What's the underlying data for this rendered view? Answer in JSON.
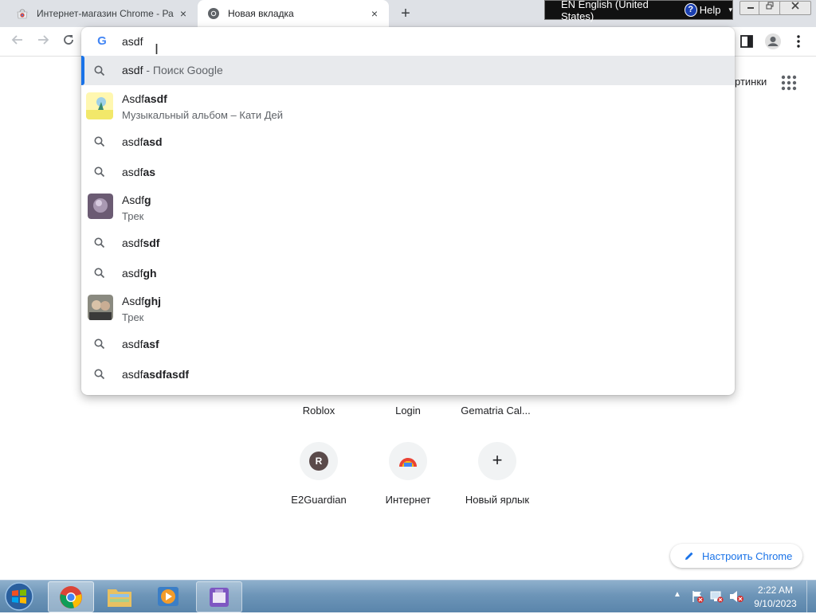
{
  "tabs": [
    {
      "title": "Интернет-магазин Chrome - Рас",
      "close_label": "×",
      "icon": "chrome-webstore-icon"
    },
    {
      "title": "Новая вкладка",
      "close_label": "×",
      "icon": "chrome-icon"
    }
  ],
  "new_tab_label": "+",
  "ime": {
    "language": "EN English (United States)",
    "help_label": "Help",
    "help_glyph": "?"
  },
  "omnibox": {
    "input_value": "asdf",
    "suggestions": [
      {
        "type": "search",
        "main": "asdf",
        "bold": "",
        "detail": " - Поиск Google",
        "selected": true
      },
      {
        "type": "entity",
        "main": "Asdf",
        "bold": "asdf",
        "subtitle": "Музыкальный альбом – Кати Дей"
      },
      {
        "type": "search",
        "main": "asdf",
        "bold": "asd"
      },
      {
        "type": "search",
        "main": "asdf",
        "bold": "as"
      },
      {
        "type": "entity",
        "main": "Asdf",
        "bold": "g",
        "subtitle": "Трек"
      },
      {
        "type": "search",
        "main": "asdf",
        "bold": "sdf"
      },
      {
        "type": "search",
        "main": "asdf",
        "bold": "gh"
      },
      {
        "type": "entity",
        "main": "Asdf",
        "bold": "ghj",
        "subtitle": "Трек"
      },
      {
        "type": "search",
        "main": "asdf",
        "bold": "asf"
      },
      {
        "type": "search",
        "main": "asdf",
        "bold": "asdfasdf"
      }
    ]
  },
  "page": {
    "images_link_partial": "ртинки",
    "shortcuts_row1": [
      "Roblox",
      "Login",
      "Gematria Cal..."
    ],
    "shortcuts_row2": [
      {
        "label": "E2Guardian",
        "initial": "R"
      },
      {
        "label": "Интернет",
        "initial": ""
      },
      {
        "label": "Новый ярлык",
        "initial": "+"
      }
    ],
    "customize_label": "Настроить Chrome"
  },
  "taskbar": {
    "time": "2:22 AM",
    "date": "9/10/2023"
  },
  "colors": {
    "accent": "#1a73e8",
    "tabstrip": "#dee1e6",
    "selected_row": "#e8eaed"
  }
}
